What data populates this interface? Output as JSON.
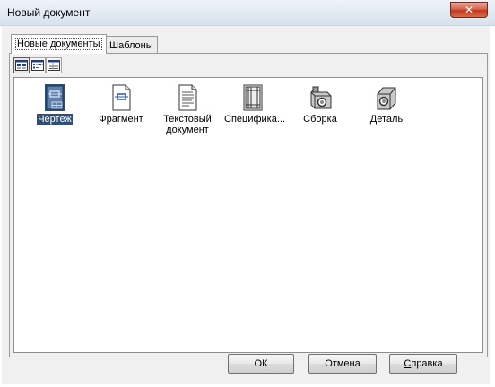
{
  "window": {
    "title": "Новый документ",
    "close_glyph": "✕"
  },
  "tabs": [
    {
      "label": "Новые документы",
      "active": true
    },
    {
      "label": "Шаблоны",
      "active": false
    }
  ],
  "view_buttons": [
    {
      "name": "large-icons-view",
      "pressed": true
    },
    {
      "name": "list-view",
      "pressed": false
    },
    {
      "name": "details-view",
      "pressed": false
    }
  ],
  "items": [
    {
      "label": "Чертеж",
      "icon": "drawing-icon",
      "selected": true
    },
    {
      "label": "Фрагмент",
      "icon": "fragment-icon",
      "selected": false
    },
    {
      "label": "Текстовый документ",
      "icon": "text-document-icon",
      "selected": false
    },
    {
      "label": "Специфика...",
      "icon": "specification-icon",
      "selected": false
    },
    {
      "label": "Сборка",
      "icon": "assembly-icon",
      "selected": false
    },
    {
      "label": "Деталь",
      "icon": "part-icon",
      "selected": false
    }
  ],
  "buttons": {
    "ok": "ОК",
    "cancel": "Отмена",
    "help_first": "С",
    "help_rest": "правка"
  },
  "colors": {
    "selection": "#2d4f78",
    "close_button": "#c0391e"
  }
}
